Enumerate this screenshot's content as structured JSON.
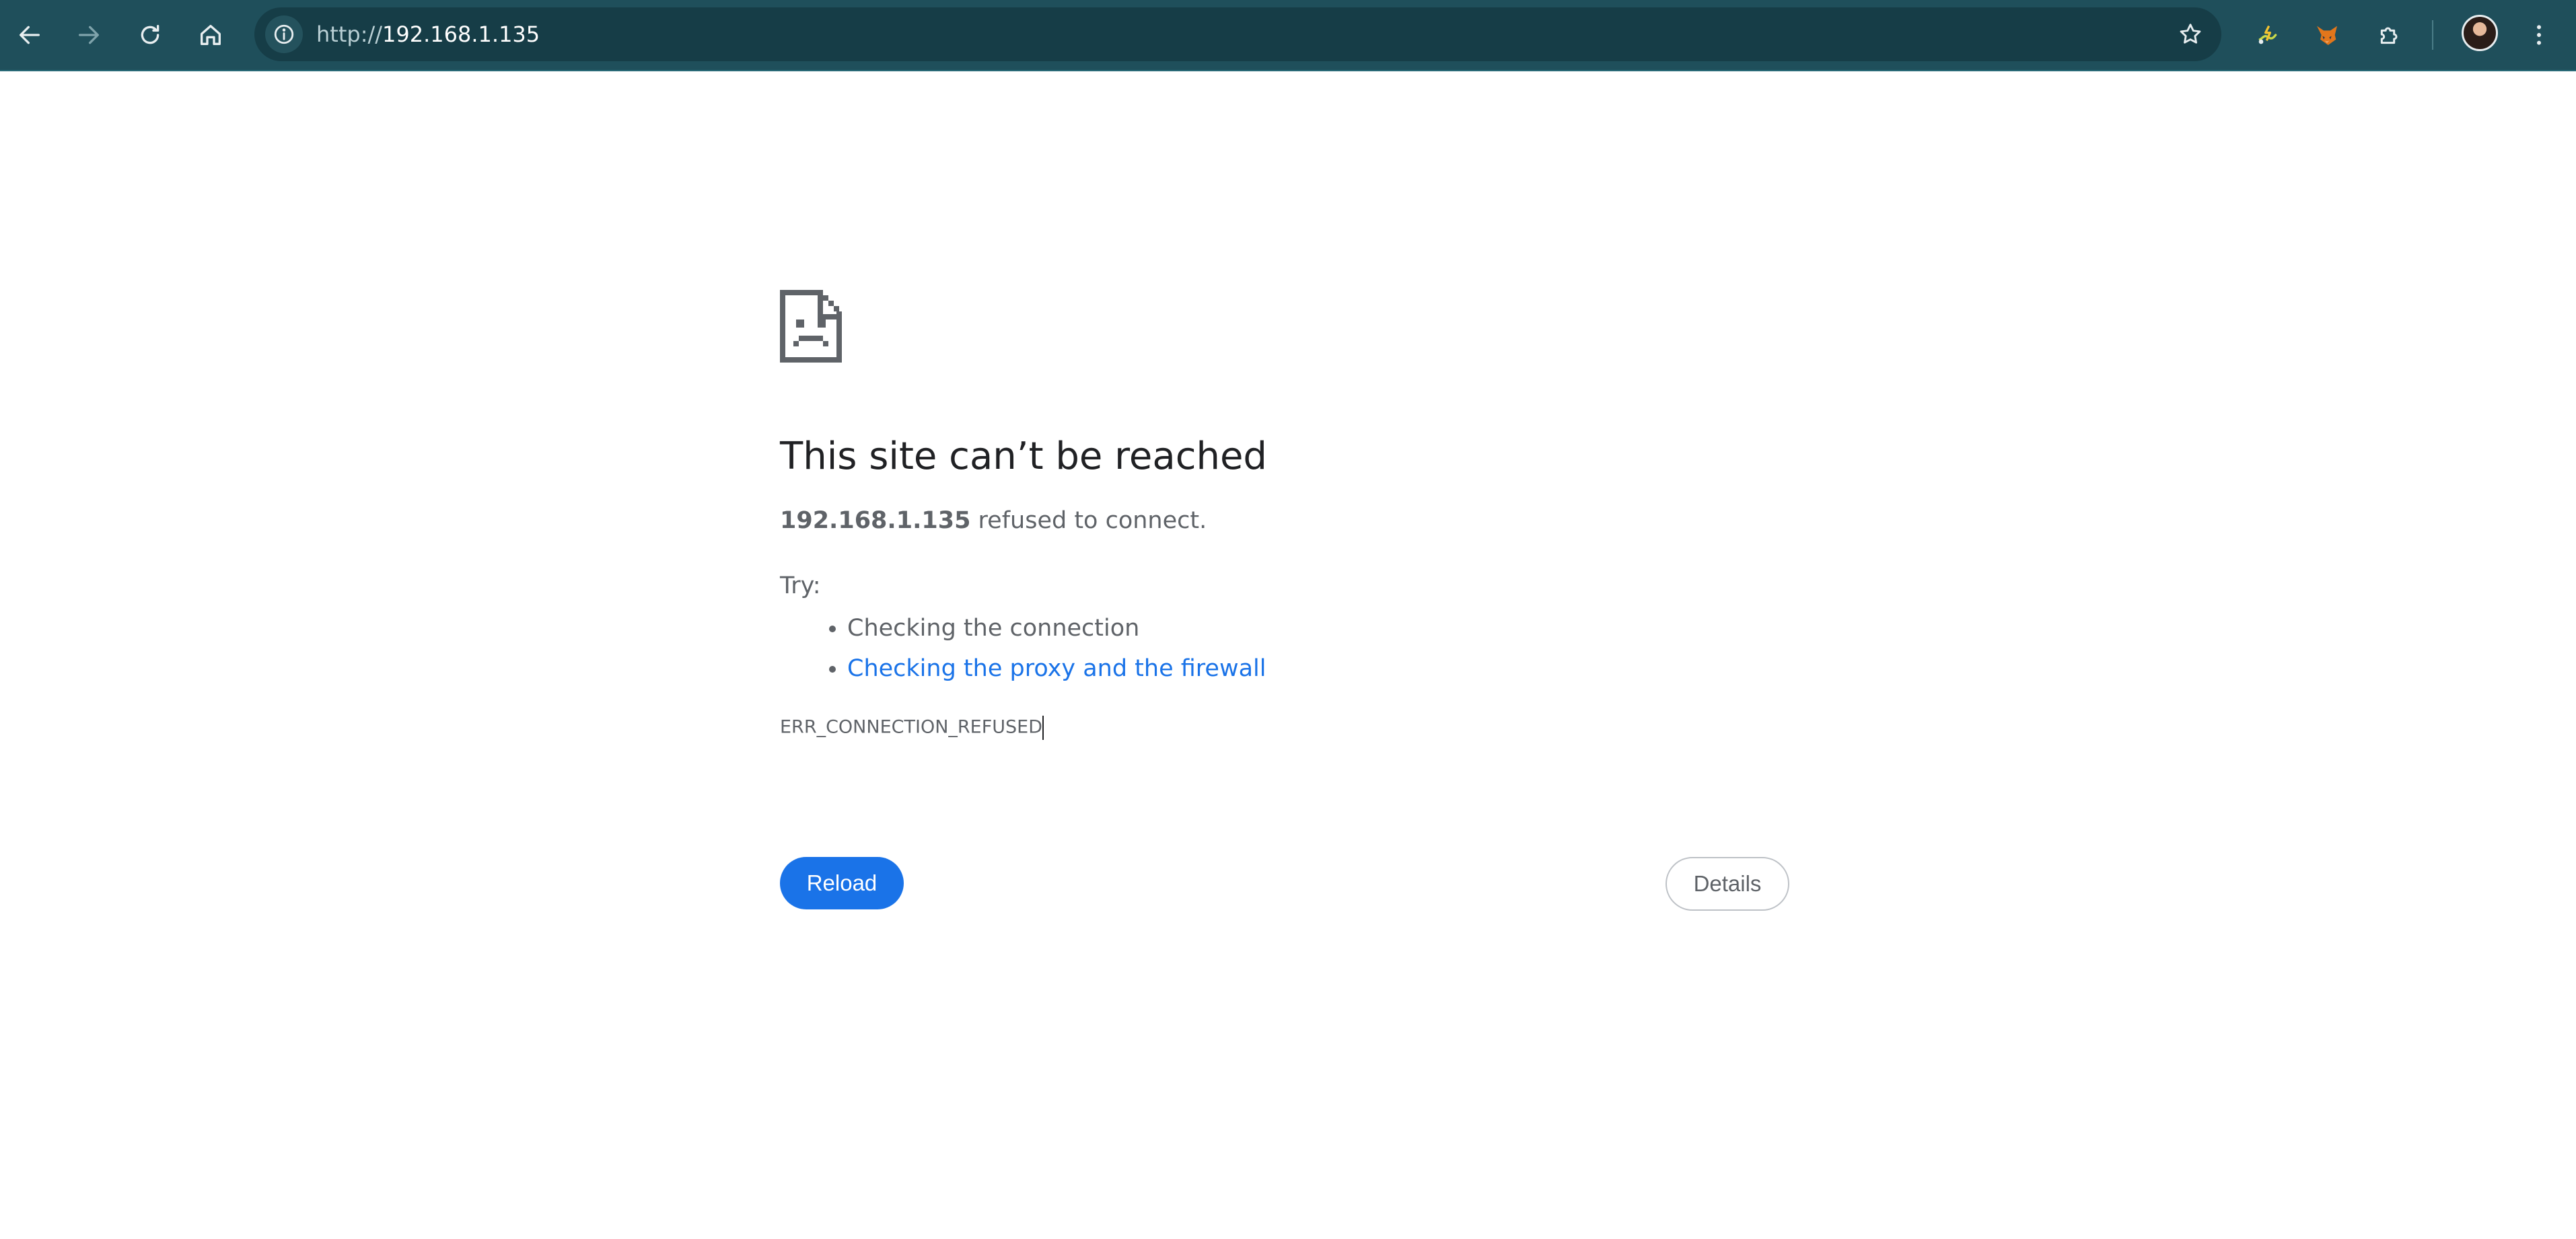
{
  "browser": {
    "url_scheme": "http://",
    "url_host": "192.168.1.135",
    "icons": {
      "back": "arrow-left-icon",
      "forward": "arrow-right-icon",
      "reload": "refresh-icon",
      "home": "home-icon",
      "site_info": "info-icon",
      "bookmark": "star-icon",
      "ext1": "puzzle-bolt-extension-icon",
      "ext2": "fox-extension-icon",
      "extensions": "puzzle-icon",
      "menu": "kebab-menu-icon"
    },
    "colors": {
      "toolbar": "#1f4f5b",
      "omnibox": "#163d47"
    }
  },
  "error_page": {
    "icon": "sad-document-icon",
    "heading": "This site can’t be reached",
    "host": "192.168.1.135",
    "summary_suffix": " refused to connect.",
    "try_label": "Try:",
    "suggestions": [
      "Checking the connection",
      "Checking the proxy and the firewall"
    ],
    "error_code": "ERR_CONNECTION_REFUSED",
    "reload_label": "Reload",
    "details_label": "Details",
    "colors": {
      "link": "#1a73e8",
      "primary_button": "#1a73e8",
      "heading": "#202124"
    }
  }
}
